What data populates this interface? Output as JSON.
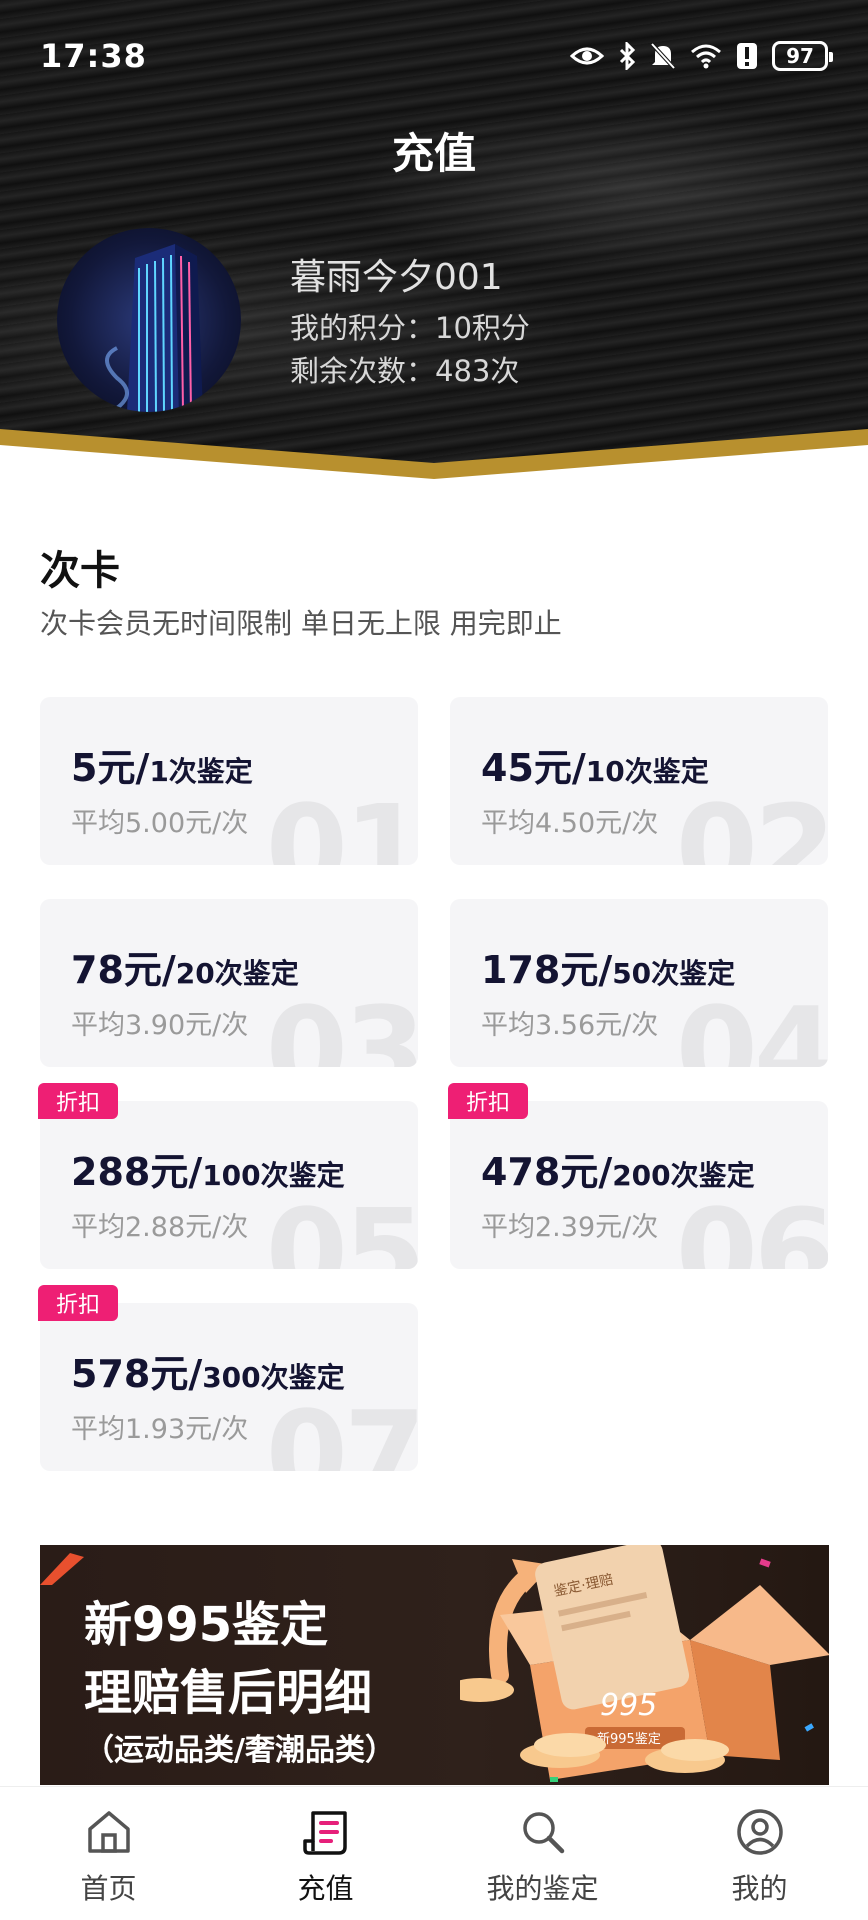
{
  "status_bar": {
    "time": "17:38",
    "battery": "97",
    "icons": [
      "eye-icon",
      "bluetooth-icon",
      "bell-off-icon",
      "wifi-icon",
      "alert-icon",
      "battery-icon"
    ]
  },
  "header": {
    "title": "充值"
  },
  "user": {
    "name": "暮雨今夕001",
    "points": "我的积分：10积分",
    "remaining": "剩余次数：483次"
  },
  "section": {
    "title": "次卡",
    "subtitle": "次卡会员无时间限制 单日无上限 用完即止"
  },
  "plans": [
    {
      "price": "5元/",
      "count": "1次鉴定",
      "avg": "平均5.00元/次",
      "num": "01",
      "badge": ""
    },
    {
      "price": "45元/",
      "count": "10次鉴定",
      "avg": "平均4.50元/次",
      "num": "02",
      "badge": ""
    },
    {
      "price": "78元/",
      "count": "20次鉴定",
      "avg": "平均3.90元/次",
      "num": "03",
      "badge": ""
    },
    {
      "price": "178元/",
      "count": "50次鉴定",
      "avg": "平均3.56元/次",
      "num": "04",
      "badge": ""
    },
    {
      "price": "288元/",
      "count": "100次鉴定",
      "avg": "平均2.88元/次",
      "num": "05",
      "badge": "折扣"
    },
    {
      "price": "478元/",
      "count": "200次鉴定",
      "avg": "平均2.39元/次",
      "num": "06",
      "badge": "折扣"
    },
    {
      "price": "578元/",
      "count": "300次鉴定",
      "avg": "平均1.93元/次",
      "num": "07",
      "badge": "折扣"
    }
  ],
  "banner": {
    "line1": "新995鉴定",
    "line2": "理赔售后明细",
    "line3": "（运动品类/奢潮品类）",
    "card_text": "鉴定·理赔",
    "box_logo": "995",
    "box_label": "新995鉴定"
  },
  "nav": {
    "items": [
      {
        "label": "首页",
        "icon": "home-icon",
        "active": false
      },
      {
        "label": "充值",
        "icon": "recharge-icon",
        "active": true
      },
      {
        "label": "我的鉴定",
        "icon": "search-icon",
        "active": false
      },
      {
        "label": "我的",
        "icon": "user-icon",
        "active": false
      }
    ]
  },
  "colors": {
    "accent_pink": "#ee1f74",
    "gold": "#b8902e",
    "card_bg": "#f5f5f7",
    "title_dark": "#141432"
  }
}
